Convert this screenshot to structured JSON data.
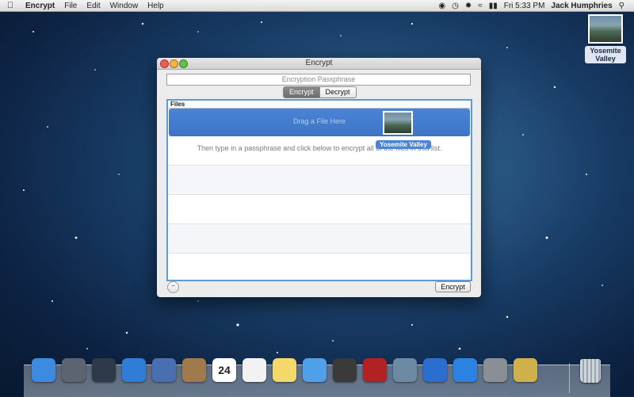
{
  "menubar": {
    "app_name": "Encrypt",
    "menus": [
      "File",
      "Edit",
      "Window",
      "Help"
    ],
    "clock": "Fri 5:33 PM",
    "user": "Jack Humphries"
  },
  "desktop": {
    "file_label": "Yosemite Valley"
  },
  "window": {
    "title": "Encrypt",
    "passphrase_placeholder": "Encryption Passphrase",
    "tabs": [
      {
        "label": "Encrypt",
        "active": true
      },
      {
        "label": "Decrypt",
        "active": false
      }
    ],
    "files_header": "Files",
    "drop_label": "Drag a File Here",
    "hint": "Then type in a passphrase and click below to encrypt all of the files in this list.",
    "drag_item_label": "Yosemite Valley",
    "remove_symbol": "−",
    "action_button": "Encrypt"
  },
  "dock": {
    "icons": [
      {
        "name": "finder-icon",
        "color": "#3d8be0"
      },
      {
        "name": "launchpad-icon",
        "color": "#5b6470"
      },
      {
        "name": "mission-control-icon",
        "color": "#2f3a48"
      },
      {
        "name": "safari-icon",
        "color": "#2f7dd6"
      },
      {
        "name": "mail-icon",
        "color": "#4a6fb0"
      },
      {
        "name": "contacts-icon",
        "color": "#a07a4a"
      },
      {
        "name": "calendar-icon",
        "color": "#ffffff"
      },
      {
        "name": "reminders-icon",
        "color": "#f2f2f2"
      },
      {
        "name": "notes-icon",
        "color": "#f3d86a"
      },
      {
        "name": "messages-icon",
        "color": "#4fa0e8"
      },
      {
        "name": "facetime-icon",
        "color": "#3a3a3a"
      },
      {
        "name": "photo-booth-icon",
        "color": "#b22222"
      },
      {
        "name": "iphoto-icon",
        "color": "#6c8aa4"
      },
      {
        "name": "itunes-icon",
        "color": "#2a6fd0"
      },
      {
        "name": "app-store-icon",
        "color": "#2b82e0"
      },
      {
        "name": "system-preferences-icon",
        "color": "#8a8f96"
      },
      {
        "name": "encrypt-app-icon",
        "color": "#d0b04a"
      }
    ],
    "calendar_day": "24"
  }
}
